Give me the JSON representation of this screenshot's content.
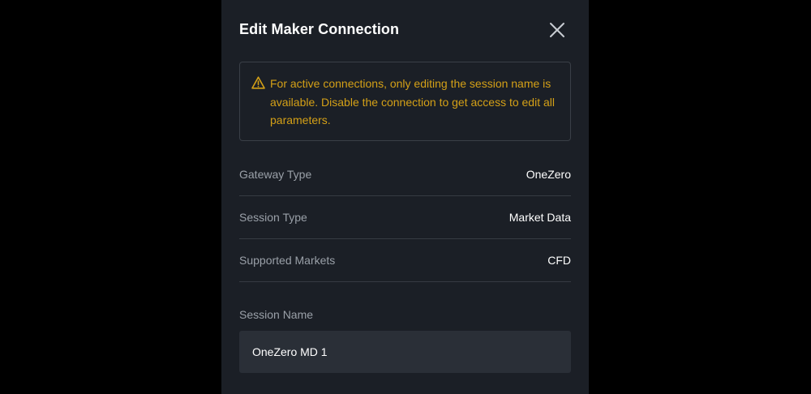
{
  "modal": {
    "title": "Edit Maker Connection",
    "close_icon": "close-icon",
    "warning": {
      "icon": "warning-icon",
      "text": "For active connections, only editing the session name is available. Disable the connection to get access to edit all parameters."
    },
    "info_rows": [
      {
        "label": "Gateway Type",
        "value": "OneZero"
      },
      {
        "label": "Session Type",
        "value": "Market Data"
      },
      {
        "label": "Supported Markets",
        "value": "CFD"
      }
    ],
    "session_name": {
      "label": "Session Name",
      "value": "OneZero MD 1"
    }
  },
  "colors": {
    "backdrop": "#000000",
    "modal_bg": "#1b1f26",
    "warning_accent": "#d4a017",
    "input_bg": "#2a2f37",
    "muted_text": "#9aa0a8",
    "primary_text": "#ffffff"
  }
}
